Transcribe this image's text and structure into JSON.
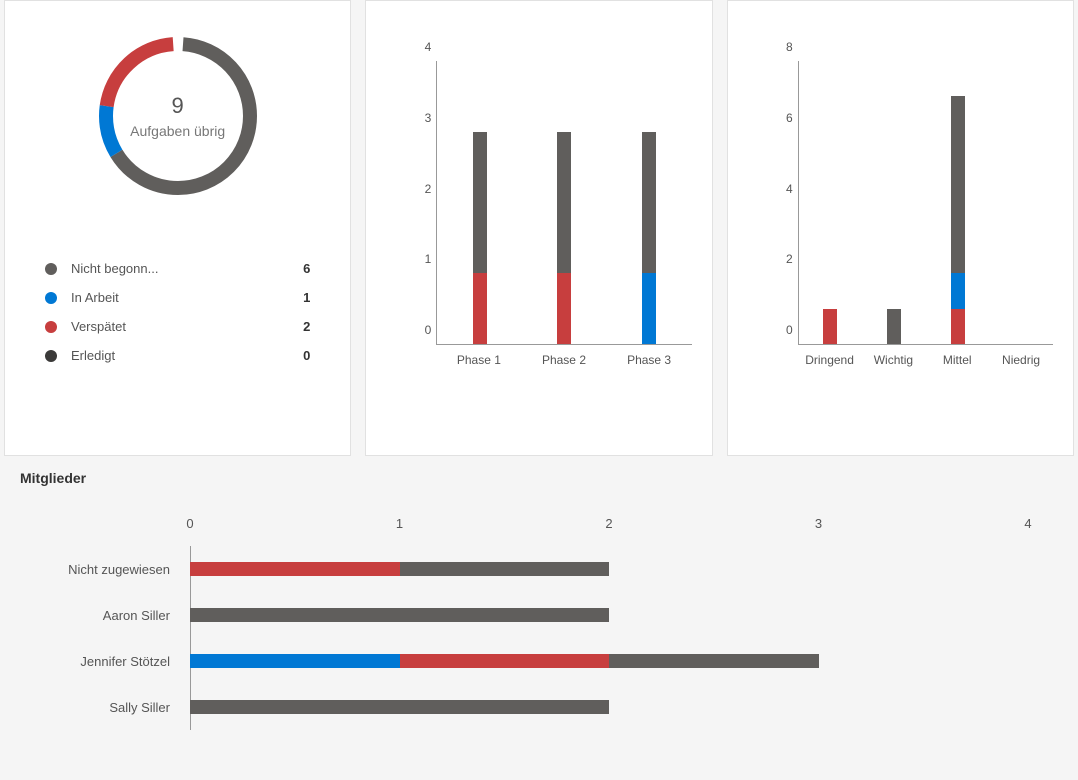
{
  "donut": {
    "center_value": "9",
    "center_label": "Aufgaben übrig",
    "total": 9,
    "legend": [
      {
        "label": "Nicht begonn...",
        "count": "6",
        "value": 6,
        "color": "#605e5c"
      },
      {
        "label": "In Arbeit",
        "count": "1",
        "value": 1,
        "color": "#0078d4"
      },
      {
        "label": "Verspätet",
        "count": "2",
        "value": 2,
        "color": "#c73e3e"
      },
      {
        "label": "Erledigt",
        "count": "0",
        "value": 0,
        "color": "#3b3a39"
      }
    ]
  },
  "chart_data": [
    {
      "type": "bar",
      "stacked": true,
      "categories": [
        "Phase 1",
        "Phase 2",
        "Phase 3"
      ],
      "series": [
        {
          "name": "Verspätet",
          "color": "#c73e3e",
          "values": [
            1,
            1,
            0
          ]
        },
        {
          "name": "In Arbeit",
          "color": "#0078d4",
          "values": [
            0,
            0,
            1
          ]
        },
        {
          "name": "Nicht begonnen",
          "color": "#605e5c",
          "values": [
            2,
            2,
            2
          ]
        }
      ],
      "ylim": [
        0,
        4
      ],
      "yticks": [
        0,
        1,
        2,
        3,
        4
      ]
    },
    {
      "type": "bar",
      "stacked": true,
      "categories": [
        "Dringend",
        "Wichtig",
        "Mittel",
        "Niedrig"
      ],
      "series": [
        {
          "name": "Verspätet",
          "color": "#c73e3e",
          "values": [
            1,
            0,
            1,
            0
          ]
        },
        {
          "name": "In Arbeit",
          "color": "#0078d4",
          "values": [
            0,
            0,
            1,
            0
          ]
        },
        {
          "name": "Nicht begonnen",
          "color": "#605e5c",
          "values": [
            0,
            1,
            5,
            0
          ]
        }
      ],
      "ylim": [
        0,
        8
      ],
      "yticks": [
        0,
        2,
        4,
        6,
        8
      ]
    },
    {
      "type": "bar",
      "orientation": "horizontal",
      "stacked": true,
      "title": "Mitglieder",
      "categories": [
        "Nicht zugewiesen",
        "Aaron Siller",
        "Jennifer Stötzel",
        "Sally Siller"
      ],
      "series": [
        {
          "name": "In Arbeit",
          "color": "#0078d4",
          "values": [
            0,
            0,
            1,
            0
          ]
        },
        {
          "name": "Verspätet",
          "color": "#c73e3e",
          "values": [
            1,
            0,
            1,
            0
          ]
        },
        {
          "name": "Nicht begonnen",
          "color": "#605e5c",
          "values": [
            1,
            2,
            1,
            2
          ]
        }
      ],
      "xlim": [
        0,
        4
      ],
      "xticks": [
        0,
        1,
        2,
        3,
        4
      ]
    }
  ]
}
